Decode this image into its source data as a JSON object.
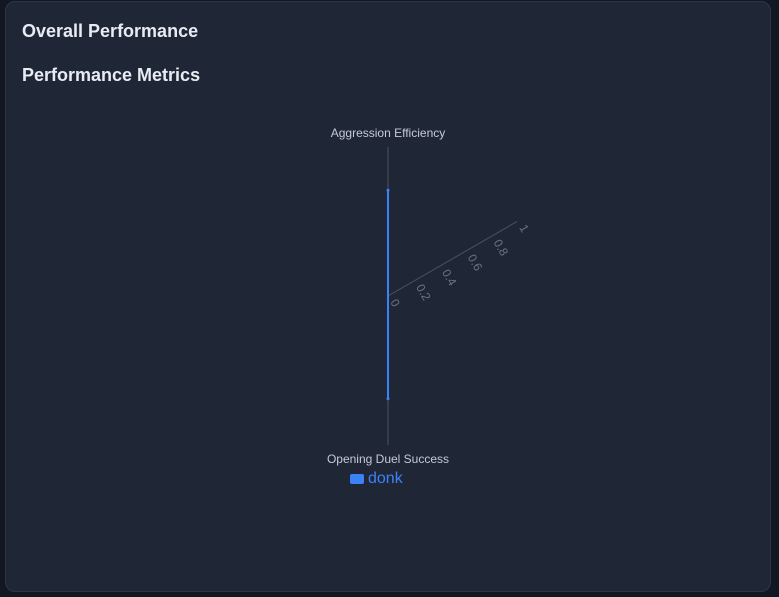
{
  "card": {
    "title": "Overall Performance"
  },
  "section": {
    "title": "Performance Metrics"
  },
  "colors": {
    "series": "#3b82f6",
    "axis": "#4b5260",
    "axis_label": "#c5cad3",
    "tick_label": "#6b7280"
  },
  "chart_data": {
    "type": "radar",
    "axes": [
      "Aggression Efficiency",
      "Opening Duel Success"
    ],
    "ticks": [
      "0",
      "0.2",
      "0.4",
      "0.6",
      "0.8",
      "1"
    ],
    "range": [
      0,
      1
    ],
    "series": [
      {
        "name": "donk",
        "values": [
          0.71,
          0.69
        ]
      }
    ],
    "legend_position": "bottom"
  }
}
